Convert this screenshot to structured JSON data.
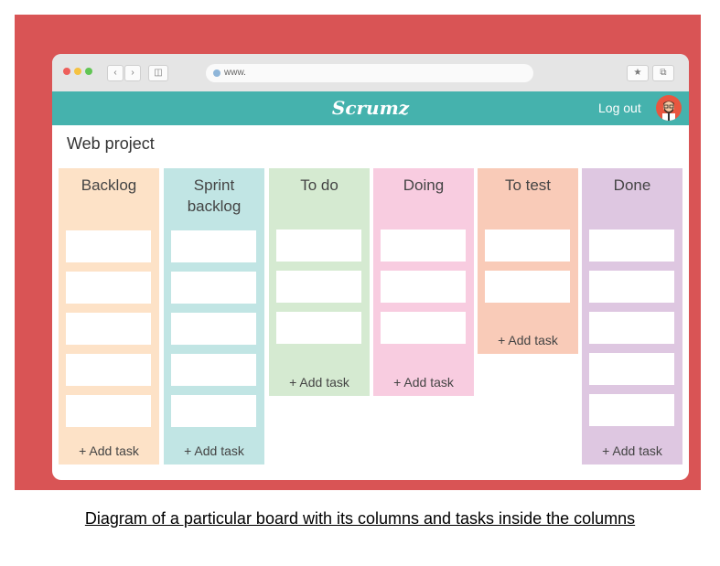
{
  "browser": {
    "url": "www.",
    "dots": [
      "#ee5f5b",
      "#f5c242",
      "#61c554"
    ]
  },
  "app": {
    "name": "Scrumz",
    "logout_label": "Log out",
    "accent": "#45b2ad"
  },
  "board": {
    "title": "Web project",
    "add_label": "+ Add task",
    "columns": [
      {
        "title": "Backlog",
        "color": "#fde2c7",
        "cards": 5
      },
      {
        "title": "Sprint backlog",
        "color": "#c1e5e4",
        "cards": 5
      },
      {
        "title": "To do",
        "color": "#d5ead1",
        "cards": 3
      },
      {
        "title": "Doing",
        "color": "#f8cce0",
        "cards": 3
      },
      {
        "title": "To test",
        "color": "#f9cbb8",
        "cards": 2
      },
      {
        "title": "Done",
        "color": "#dec7e1",
        "cards": 5
      }
    ]
  },
  "caption": "Diagram of a particular board with its columns and tasks inside the columns"
}
